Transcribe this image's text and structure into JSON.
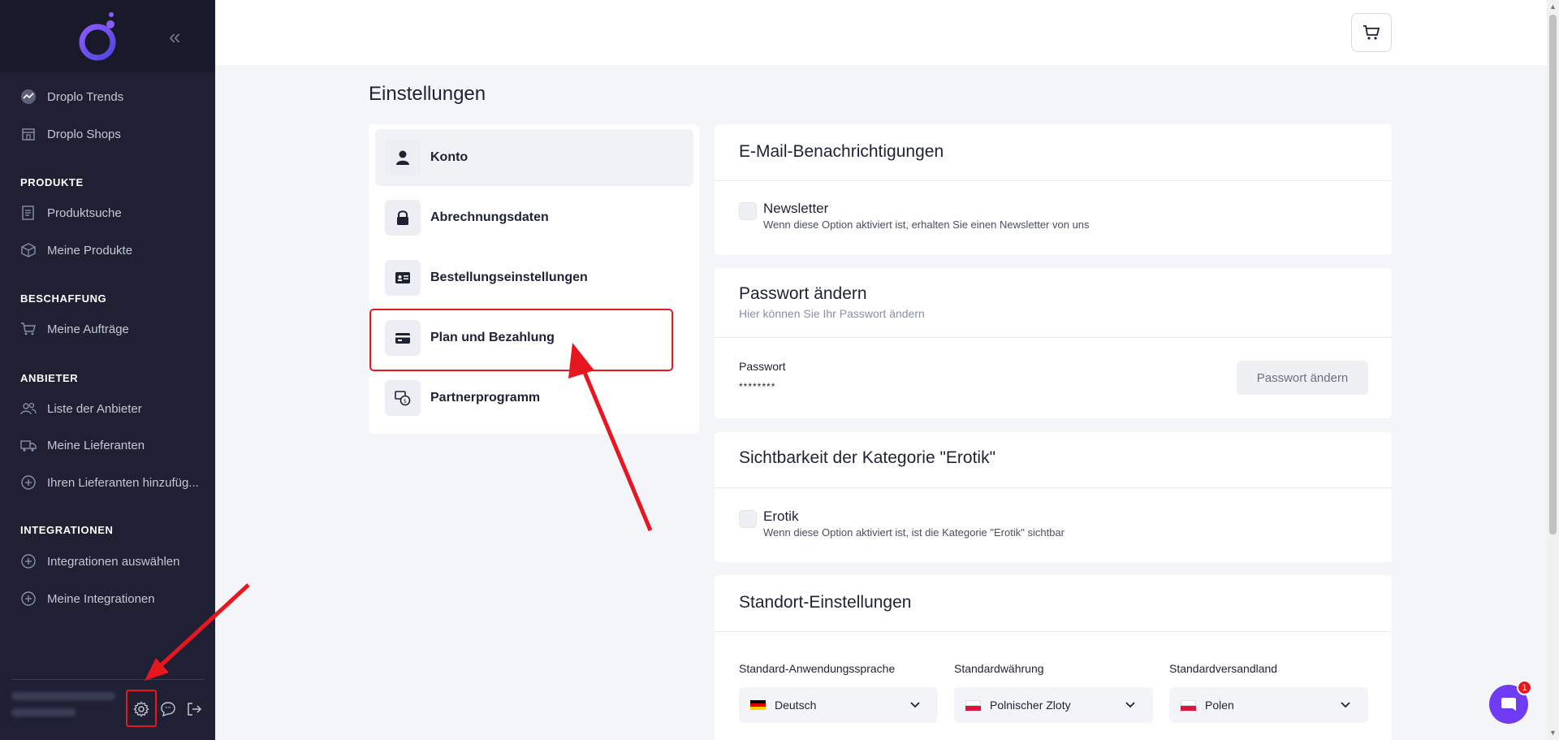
{
  "sidebar": {
    "top_items": [
      {
        "label": "Droplo Trends",
        "icon": "trend-icon"
      },
      {
        "label": "Droplo Shops",
        "icon": "store-icon"
      }
    ],
    "sections": [
      {
        "title": "PRODUKTE",
        "items": [
          {
            "label": "Produktsuche",
            "icon": "list-search-icon"
          },
          {
            "label": "Meine Produkte",
            "icon": "box-icon"
          }
        ]
      },
      {
        "title": "BESCHAFFUNG",
        "items": [
          {
            "label": "Meine Aufträge",
            "icon": "cart-icon"
          }
        ]
      },
      {
        "title": "ANBIETER",
        "items": [
          {
            "label": "Liste der Anbieter",
            "icon": "users-icon"
          },
          {
            "label": "Meine Lieferanten",
            "icon": "truck-icon"
          },
          {
            "label": "Ihren Lieferanten hinzufüg...",
            "icon": "plus-circle-icon"
          }
        ]
      },
      {
        "title": "INTEGRATIONEN",
        "items": [
          {
            "label": "Integrationen auswählen",
            "icon": "plus-circle-icon"
          },
          {
            "label": "Meine Integrationen",
            "icon": "plus-circle-icon"
          }
        ]
      }
    ],
    "bottom_icons": [
      "gear-icon",
      "chat-quote-icon",
      "logout-icon"
    ]
  },
  "page": {
    "title": "Einstellungen"
  },
  "settings_menu": [
    {
      "label": "Konto",
      "icon": "user-icon",
      "active": true
    },
    {
      "label": "Abrechnungsdaten",
      "icon": "lock-icon",
      "active": false
    },
    {
      "label": "Bestellungseinstellungen",
      "icon": "id-card-icon",
      "active": false
    },
    {
      "label": "Plan und Bezahlung",
      "icon": "credit-card-icon",
      "active": false
    },
    {
      "label": "Partnerprogramm",
      "icon": "money-swap-icon",
      "active": false
    }
  ],
  "email_card": {
    "title": "E-Mail-Benachrichtigungen",
    "newsletter_label": "Newsletter",
    "newsletter_help": "Wenn diese Option aktiviert ist, erhalten Sie einen Newsletter von uns"
  },
  "password_card": {
    "title": "Passwort ändern",
    "subtitle": "Hier können Sie Ihr Passwort ändern",
    "field_label": "Passwort",
    "field_value": "********",
    "button_label": "Passwort ändern"
  },
  "erotik_card": {
    "title": "Sichtbarkeit der Kategorie \"Erotik\"",
    "checkbox_label": "Erotik",
    "checkbox_help": "Wenn diese Option aktiviert ist, ist die Kategorie \"Erotik\" sichtbar"
  },
  "location_card": {
    "title": "Standort-Einstellungen",
    "language_label": "Standard-Anwendungssprache",
    "language_value": "Deutsch",
    "currency_label": "Standardwährung",
    "currency_value": "Polnischer Zloty",
    "shipping_label": "Standardversandland",
    "shipping_value": "Polen"
  },
  "chat": {
    "badge_count": "1"
  },
  "colors": {
    "sidebar_bg": "#1f2033",
    "accent": "#6f3bf5",
    "highlight": "#e8171f"
  }
}
